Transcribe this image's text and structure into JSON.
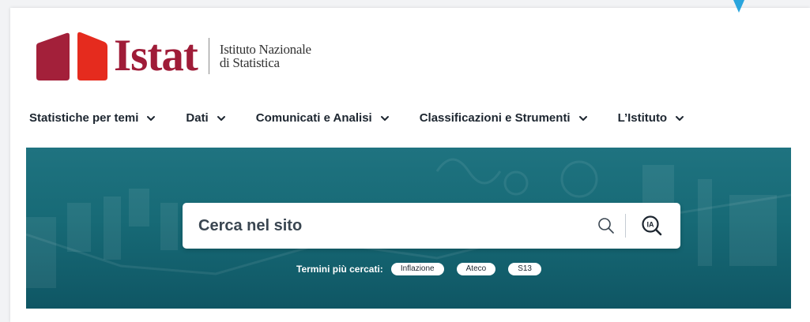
{
  "brand": {
    "logo_word": "Istat",
    "subtitle_line1": "Istituto Nazionale",
    "subtitle_line2": "di Statistica",
    "colors": {
      "logo_left": "#a3203a",
      "logo_right": "#e52b1e",
      "logo_text": "#9f1c38"
    }
  },
  "nav": {
    "items": [
      {
        "label": "Statistiche per temi",
        "icon": "chevron-down-icon"
      },
      {
        "label": "Dati",
        "icon": "chevron-down-icon"
      },
      {
        "label": "Comunicati e Analisi",
        "icon": "chevron-down-icon"
      },
      {
        "label": "Classificazioni e Strumenti",
        "icon": "chevron-down-icon"
      },
      {
        "label": "L’Istituto",
        "icon": "chevron-down-icon"
      }
    ]
  },
  "hero": {
    "background_color": "#176a76",
    "search": {
      "placeholder": "Cerca nel sito",
      "value": "",
      "search_icon": "search-icon",
      "ai_icon": "ia-search-icon",
      "ai_icon_text": "IA"
    },
    "top_terms": {
      "label": "Termini più cercati:",
      "terms": [
        "Inflazione",
        "Ateco",
        "S13"
      ]
    }
  }
}
